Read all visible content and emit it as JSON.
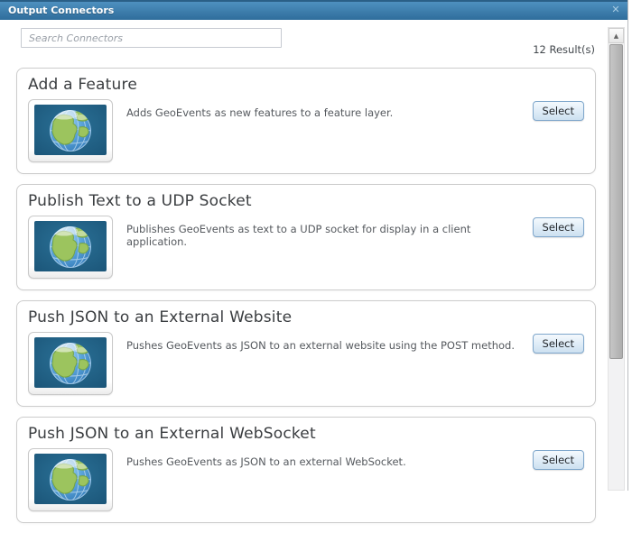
{
  "window": {
    "title": "Output Connectors",
    "close_icon": "✕"
  },
  "search": {
    "placeholder": "Search Connectors"
  },
  "results_count": "12 Result(s)",
  "connectors": [
    {
      "title": "Add a Feature",
      "description": "Adds GeoEvents as new features to a feature layer.",
      "icon": "globe-icon",
      "select_label": "Select"
    },
    {
      "title": "Publish Text to a UDP Socket",
      "description": "Publishes GeoEvents as text to a UDP socket for display in a client application.",
      "icon": "globe-icon",
      "select_label": "Select"
    },
    {
      "title": "Push JSON to an External Website",
      "description": "Pushes GeoEvents as JSON to an external website using the POST method.",
      "icon": "globe-icon",
      "select_label": "Select"
    },
    {
      "title": "Push JSON to an External WebSocket",
      "description": "Pushes GeoEvents as JSON to an external WebSocket.",
      "icon": "globe-icon",
      "select_label": "Select"
    }
  ],
  "scrollbar": {
    "up_arrow": "▲"
  },
  "colors": {
    "titlebar_top": "#4e90c0",
    "titlebar_bottom": "#2f6d9c",
    "card_border": "#cccccc",
    "select_button_border": "#7ea6cb",
    "select_button_fill": "#cce0f0",
    "thumb_background": "#1d5a7d",
    "ocean_blue": "#4a90cd",
    "continent_green": "#9cc45e"
  }
}
